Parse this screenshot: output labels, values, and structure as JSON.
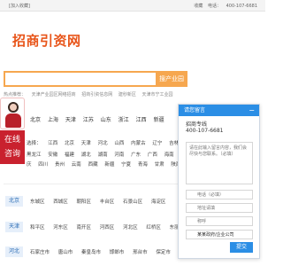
{
  "topbar": {
    "fav": "[加入收藏]",
    "items": [
      "收藏",
      "电话：",
      "400-107-6681"
    ]
  },
  "brand": {
    "logo": "招商引资网"
  },
  "search": {
    "value": "",
    "placeholder": "",
    "button": "搜产业园"
  },
  "hot": {
    "label": "热点推荐：",
    "items": [
      "天津产业园区网络招商",
      "招商引资信息网",
      "建秒新区",
      "天津市宁工业园"
    ]
  },
  "cities": [
    "北京",
    "上海",
    "天津",
    "江苏",
    "山东",
    "浙江",
    "江西",
    "新疆"
  ],
  "provinces": {
    "row1": [
      "选择：",
      "江西",
      "北京",
      "天津",
      "河北",
      "山西",
      "内蒙古",
      "辽宁",
      "吉林"
    ],
    "row2": [
      "黑龙江",
      "安徽",
      "福建",
      "湖北",
      "湖南",
      "河南",
      "广东",
      "广西",
      "海南"
    ],
    "row3": [
      "庆",
      "四川",
      "贵州",
      "云南",
      "西藏",
      "新疆",
      "宁夏",
      "青海",
      "甘肃",
      "陕西"
    ]
  },
  "widget": {
    "online": "在线\n咨询"
  },
  "regions": [
    {
      "name": "北京",
      "items": [
        "东城区",
        "西城区",
        "朝阳区",
        "丰台区",
        "石景山区",
        "海淀区"
      ]
    },
    {
      "name": "天津",
      "items": [
        "和平区",
        "河东区",
        "南开区",
        "河西区",
        "河北区",
        "红桥区",
        "东丽区"
      ]
    },
    {
      "name": "河北",
      "items": [
        "石家庄市",
        "唐山市",
        "秦皇岛市",
        "邯郸市",
        "邢台市",
        "保定市"
      ]
    }
  ],
  "panel": {
    "title": "请您留言",
    "minimize": "−",
    "label": "招商专线",
    "phone": "400-107-6681",
    "message_placeholder": "请在此输入留言内容，我们会尽快与您联系。（必填）",
    "phone_placeholder": "电话（必填）",
    "address_placeholder": "地址请填",
    "name_placeholder": "称呼",
    "company_value": "某某政府/企业公司",
    "submit": "提交"
  }
}
